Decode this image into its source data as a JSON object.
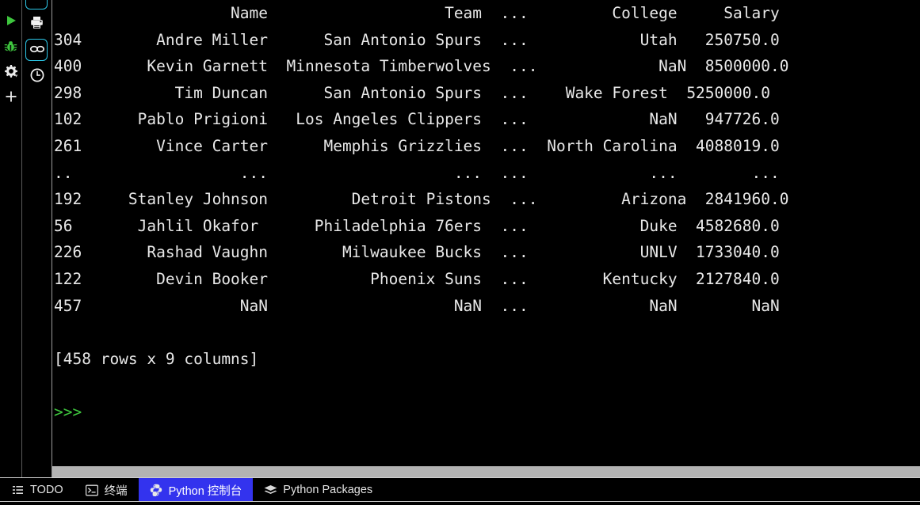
{
  "run_toolbar": {
    "items": [
      {
        "name": "run-button",
        "icon": "play-icon",
        "color": "#3ec63e",
        "title": "Run"
      },
      {
        "name": "debug-button",
        "icon": "bug-icon",
        "color": "#3ec63e",
        "title": "Debug"
      },
      {
        "name": "settings-button",
        "icon": "gear-icon",
        "color": "#e8e8e8",
        "title": "Settings"
      },
      {
        "name": "add-button",
        "icon": "plus-icon",
        "color": "#e8e8e8",
        "title": "Add"
      }
    ]
  },
  "tool_rail": {
    "items": [
      {
        "name": "rerun-button",
        "icon": "rerun-icon",
        "selected": true,
        "cut_off": true
      },
      {
        "name": "print-button",
        "icon": "printer-icon",
        "selected": false,
        "cut_off": false
      },
      {
        "name": "variables-button",
        "icon": "glasses-icon",
        "selected": true,
        "cut_off": false
      },
      {
        "name": "history-button",
        "icon": "clock-icon",
        "selected": false,
        "cut_off": false
      }
    ],
    "selected_border_color": "#2dc8e8"
  },
  "console": {
    "prompt_symbol": ">>>",
    "prompt_color": "#3ec63e",
    "text_color": "#e8e8e8",
    "background": "#000000",
    "summary": "[458 rows x 9 columns]",
    "dataframe": {
      "index_header": "",
      "columns": [
        "Name",
        "Team",
        "...",
        "College",
        "Salary"
      ],
      "rows": [
        {
          "index": "304",
          "Name": "Andre Miller",
          "Team": "San Antonio Spurs",
          "ellipsis": "...",
          "College": "Utah",
          "Salary": "250750.0"
        },
        {
          "index": "400",
          "Name": "Kevin Garnett",
          "Team": "Minnesota Timberwolves",
          "ellipsis": "...",
          "College": "NaN",
          "Salary": "8500000.0"
        },
        {
          "index": "298",
          "Name": "Tim Duncan",
          "Team": "San Antonio Spurs",
          "ellipsis": "...",
          "College": "Wake Forest",
          "Salary": "5250000.0"
        },
        {
          "index": "102",
          "Name": "Pablo Prigioni",
          "Team": "Los Angeles Clippers",
          "ellipsis": "...",
          "College": "NaN",
          "Salary": "947726.0"
        },
        {
          "index": "261",
          "Name": "Vince Carter",
          "Team": "Memphis Grizzlies",
          "ellipsis": "...",
          "College": "North Carolina",
          "Salary": "4088019.0"
        },
        {
          "index": "..",
          "Name": "...",
          "Team": "...",
          "ellipsis": "...",
          "College": "...",
          "Salary": "..."
        },
        {
          "index": "192",
          "Name": "Stanley Johnson",
          "Team": "Detroit Pistons",
          "ellipsis": "...",
          "College": "Arizona",
          "Salary": "2841960.0"
        },
        {
          "index": "56",
          "Name": "Jahlil Okafor",
          "Team": "Philadelphia 76ers",
          "ellipsis": "...",
          "College": "Duke",
          "Salary": "4582680.0"
        },
        {
          "index": "226",
          "Name": "Rashad Vaughn",
          "Team": "Milwaukee Bucks",
          "ellipsis": "...",
          "College": "UNLV",
          "Salary": "1733040.0"
        },
        {
          "index": "122",
          "Name": "Devin Booker",
          "Team": "Phoenix Suns",
          "ellipsis": "...",
          "College": "Kentucky",
          "Salary": "2127840.0"
        },
        {
          "index": "457",
          "Name": "NaN",
          "Team": "NaN",
          "ellipsis": "...",
          "College": "NaN",
          "Salary": "NaN"
        }
      ]
    },
    "rendered_text": "                   Name                   Team  ...         College     Salary\n304        Andre Miller      San Antonio Spurs  ...            Utah   250750.0\n400       Kevin Garnett  Minnesota Timberwolves  ...             NaN  8500000.0\n298          Tim Duncan      San Antonio Spurs  ...    Wake Forest  5250000.0\n102      Pablo Prigioni   Los Angeles Clippers  ...             NaN   947726.0\n261        Vince Carter      Memphis Grizzlies  ...  North Carolina  4088019.0\n..                  ...                    ...  ...             ...        ...\n192     Stanley Johnson         Detroit Pistons  ...         Arizona  2841960.0\n56       Jahlil Okafor      Philadelphia 76ers  ...            Duke  4582680.0\n226       Rashad Vaughn        Milwaukee Bucks  ...            UNLV  1733040.0\n122        Devin Booker           Phoenix Suns  ...        Kentucky  2127840.0\n457                 NaN                    NaN  ...             NaN        NaN"
  },
  "statusbar": {
    "items": [
      {
        "name": "statusbar-tab-todo",
        "label": "TODO",
        "icon": "list-icon",
        "active": false
      },
      {
        "name": "statusbar-tab-terminal",
        "label": "终端",
        "icon": "terminal-icon",
        "active": false
      },
      {
        "name": "statusbar-tab-python-console",
        "label": "Python 控制台",
        "icon": "python-icon",
        "active": true
      },
      {
        "name": "statusbar-tab-python-packages",
        "label": "Python Packages",
        "icon": "layers-icon",
        "active": false
      }
    ],
    "active_color": "#3333ee"
  }
}
